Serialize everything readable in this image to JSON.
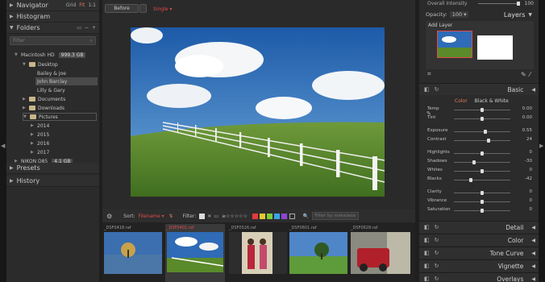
{
  "left": {
    "sections": {
      "navigator": "Navigator",
      "histogram": "Histogram",
      "folders": "Folders",
      "presets": "Presets",
      "history": "History"
    },
    "nav_opts": [
      "Grid",
      "Fit",
      "1:1"
    ],
    "filter_placeholder": "Filter",
    "drive": {
      "label": "Macintosh HD",
      "size": "999.3 GB"
    },
    "tree": [
      "Desktop",
      "Bailey & Joe",
      "John Barclay",
      "Lilly & Gary",
      "Documents",
      "Downloads",
      "Pictures",
      "2014",
      "2015",
      "2016",
      "2017"
    ],
    "drive2": {
      "label": "NIKON D85",
      "size": "4.1 GB"
    }
  },
  "center": {
    "before": "Before",
    "style": "Single",
    "sort_label": "Sort:",
    "sort_value": "Filename",
    "filter_label": "Filter:",
    "filter_placeholder": "Filter by metadata",
    "label_colors": [
      "#e23b3b",
      "#e6c933",
      "#7ccf3a",
      "#3aa4e6",
      "#8d45d8"
    ],
    "thumbs": [
      "_DSF0418.raf",
      "_DSF0401.raf",
      "_DSF0526.raf",
      "_DSF0601.raf",
      "_DSF0628.raf"
    ]
  },
  "right": {
    "overall": "Overall Intensity",
    "overall_val": "100",
    "opacity_label": "Opacity:",
    "opacity_val": "100",
    "layers": "Layers",
    "add_layer": "Add Layer",
    "basic": "Basic",
    "color": "Color",
    "bw": "Black & White",
    "sliders": [
      {
        "name": "Temp",
        "value": "0.00",
        "pos": 0.5
      },
      {
        "name": "Tint",
        "value": "0.00",
        "pos": 0.5
      },
      {
        "name": "Exposure",
        "value": "0.55",
        "pos": 0.55
      },
      {
        "name": "Contrast",
        "value": "24",
        "pos": 0.62
      },
      {
        "name": "Highlights",
        "value": "0",
        "pos": 0.5
      },
      {
        "name": "Shadows",
        "value": "-30",
        "pos": 0.35
      },
      {
        "name": "Whites",
        "value": "0",
        "pos": 0.5
      },
      {
        "name": "Blacks",
        "value": "-42",
        "pos": 0.3
      },
      {
        "name": "Clarity",
        "value": "0",
        "pos": 0.5
      },
      {
        "name": "Vibrance",
        "value": "0",
        "pos": 0.5
      },
      {
        "name": "Saturation",
        "value": "0",
        "pos": 0.5
      }
    ],
    "panels": [
      "Detail",
      "Color",
      "Tone Curve",
      "Vignette",
      "Overlays"
    ]
  }
}
